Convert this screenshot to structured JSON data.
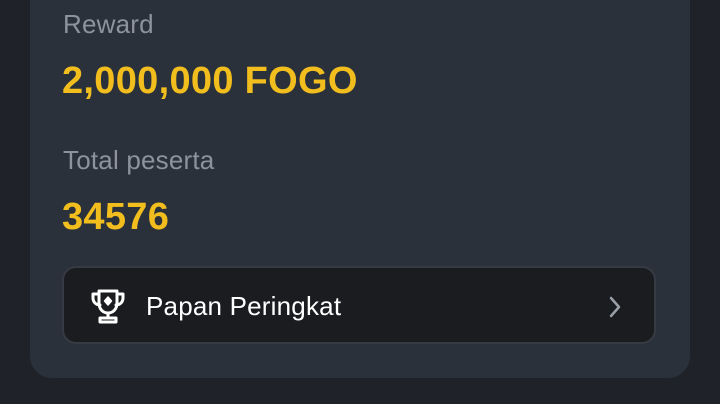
{
  "reward": {
    "label": "Reward",
    "value": "2,000,000 FOGO"
  },
  "participants": {
    "label": "Total peserta",
    "value": "34576"
  },
  "leaderboard": {
    "label": "Papan Peringkat",
    "icon": "trophy-icon",
    "chevron_icon": "chevron-right-icon"
  },
  "colors": {
    "background": "#1f2329",
    "card": "#2b313b",
    "accent": "#f2be1e",
    "muted_text": "#8d939c",
    "button": "#1a1c20"
  }
}
